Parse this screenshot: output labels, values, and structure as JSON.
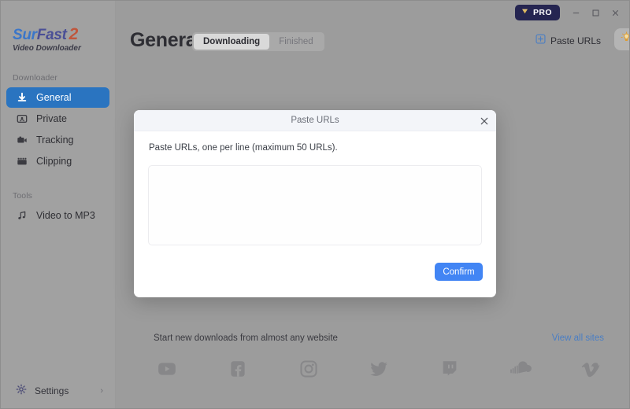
{
  "window": {
    "pro_label": "PRO",
    "minimize": "—",
    "maximize": "□",
    "close": "✕"
  },
  "sidebar": {
    "logo": {
      "part1": "Sur",
      "part2": "Fast",
      "part3": "2",
      "subtitle": "Video Downloader"
    },
    "sections": [
      {
        "label": "Downloader"
      },
      {
        "label": "Tools"
      }
    ],
    "items": [
      {
        "label": "General",
        "icon": "download-arrow-icon",
        "active": true
      },
      {
        "label": "Private",
        "icon": "private-user-icon",
        "active": false
      },
      {
        "label": "Tracking",
        "icon": "camera-icon",
        "active": false
      },
      {
        "label": "Clipping",
        "icon": "clapperboard-icon",
        "active": false
      },
      {
        "label": "Video to MP3",
        "icon": "music-note-icon",
        "active": false
      }
    ],
    "settings": {
      "label": "Settings",
      "icon": "gear-icon",
      "chevron": "›"
    }
  },
  "header": {
    "title": "General",
    "tabs": [
      {
        "label": "Downloading",
        "active": true
      },
      {
        "label": "Finished",
        "active": false
      }
    ],
    "paste_urls_button": "Paste URLs",
    "tip_icon": "lightbulb-icon"
  },
  "promo": {
    "text": "Start new downloads from almost any website",
    "link": "View all sites",
    "sites": [
      {
        "name": "youtube"
      },
      {
        "name": "facebook"
      },
      {
        "name": "instagram"
      },
      {
        "name": "twitter"
      },
      {
        "name": "twitch"
      },
      {
        "name": "soundcloud"
      },
      {
        "name": "vimeo"
      }
    ]
  },
  "dialog": {
    "title": "Paste URLs",
    "close": "✕",
    "instruction": "Paste URLs, one per line (maximum 50 URLs).",
    "textarea_value": "",
    "textarea_placeholder": "",
    "confirm_label": "Confirm"
  },
  "colors": {
    "accent_blue": "#2a74c0",
    "button_blue": "#4285f4",
    "link_blue": "#4a7ec4",
    "pro_navy": "#252551",
    "pro_gold": "#d9b45a"
  }
}
